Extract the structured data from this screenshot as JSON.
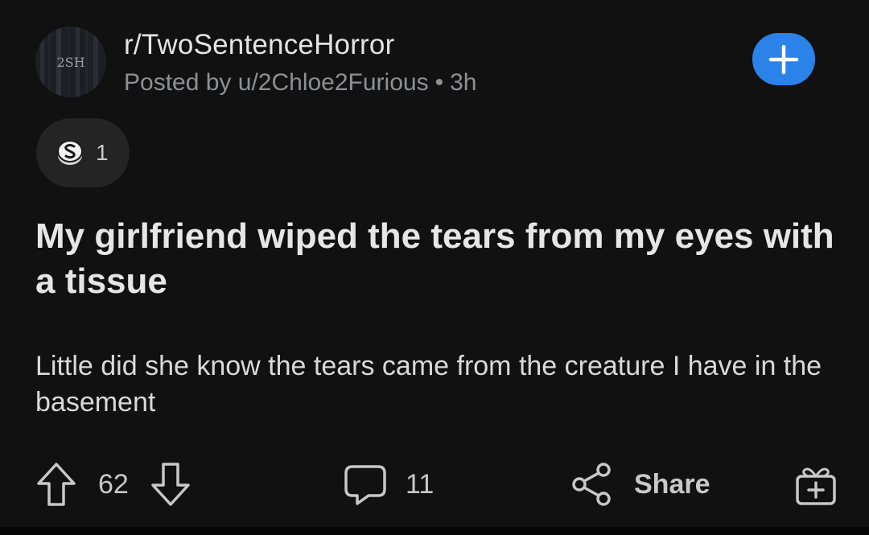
{
  "header": {
    "subreddit": "r/TwoSentenceHorror",
    "posted_by_prefix": "Posted by",
    "username": "u/2Chloe2Furious",
    "separator": "•",
    "time_ago": "3h",
    "avatar_text": "2SH",
    "join_icon": "plus-icon"
  },
  "awards": {
    "icon": "silver-award-icon",
    "count": "1"
  },
  "post": {
    "title": "My girlfriend wiped the tears from my eyes with a tissue",
    "body": "Little did she know the tears came from the creature I have in the basement"
  },
  "actions": {
    "upvote_icon": "arrow-up-icon",
    "score": "62",
    "downvote_icon": "arrow-down-icon",
    "comment_icon": "comment-bubble-icon",
    "comment_count": "11",
    "share_icon": "share-icon",
    "share_label": "Share",
    "gift_icon": "gift-icon"
  },
  "colors": {
    "background": "#111111",
    "accent_blue": "#2b82e8",
    "text_primary": "#e6e6e6",
    "text_muted": "#8e9093"
  }
}
